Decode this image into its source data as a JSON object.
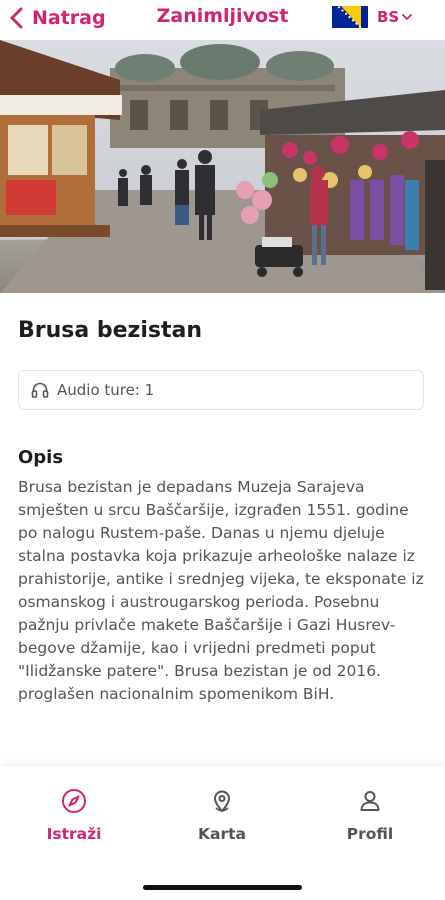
{
  "header": {
    "back_label": "Natrag",
    "title": "Zanimljivost",
    "language_code": "BS"
  },
  "place": {
    "name": "Brusa bezistan",
    "audio_tours_label": "Audio ture: 1",
    "description_heading": "Opis",
    "description": "Brusa bezistan je depadans Muzeja Sarajeva smješten u srcu Baščaršije, izgrađen 1551. godine po nalogu Rustem-paše. Danas u njemu djeluje stalna postavka koja prikazuje arheološke nalaze iz prahistorije, antike i srednjeg vijeka, te eksponate iz osmanskog i austrougarskog perioda. Posebnu pažnju privlače makete Baščaršije i Gazi Husrev-begove džamije, kao i vrijedni predmeti poput \"Ilidžanske patere\". Brusa bezistan je od 2016. proglašen nacionalnim spomenikom BiH."
  },
  "bottom_nav": {
    "items": [
      {
        "label": "Istraži",
        "icon": "compass-icon",
        "active": true
      },
      {
        "label": "Karta",
        "icon": "map-pin-icon",
        "active": false
      },
      {
        "label": "Profil",
        "icon": "user-icon",
        "active": false
      }
    ]
  },
  "colors": {
    "accent": "#d1246e",
    "text_dark": "#1e1e1e",
    "text_muted": "#555555",
    "flag_blue": "#002395",
    "flag_yellow": "#fecb00"
  }
}
